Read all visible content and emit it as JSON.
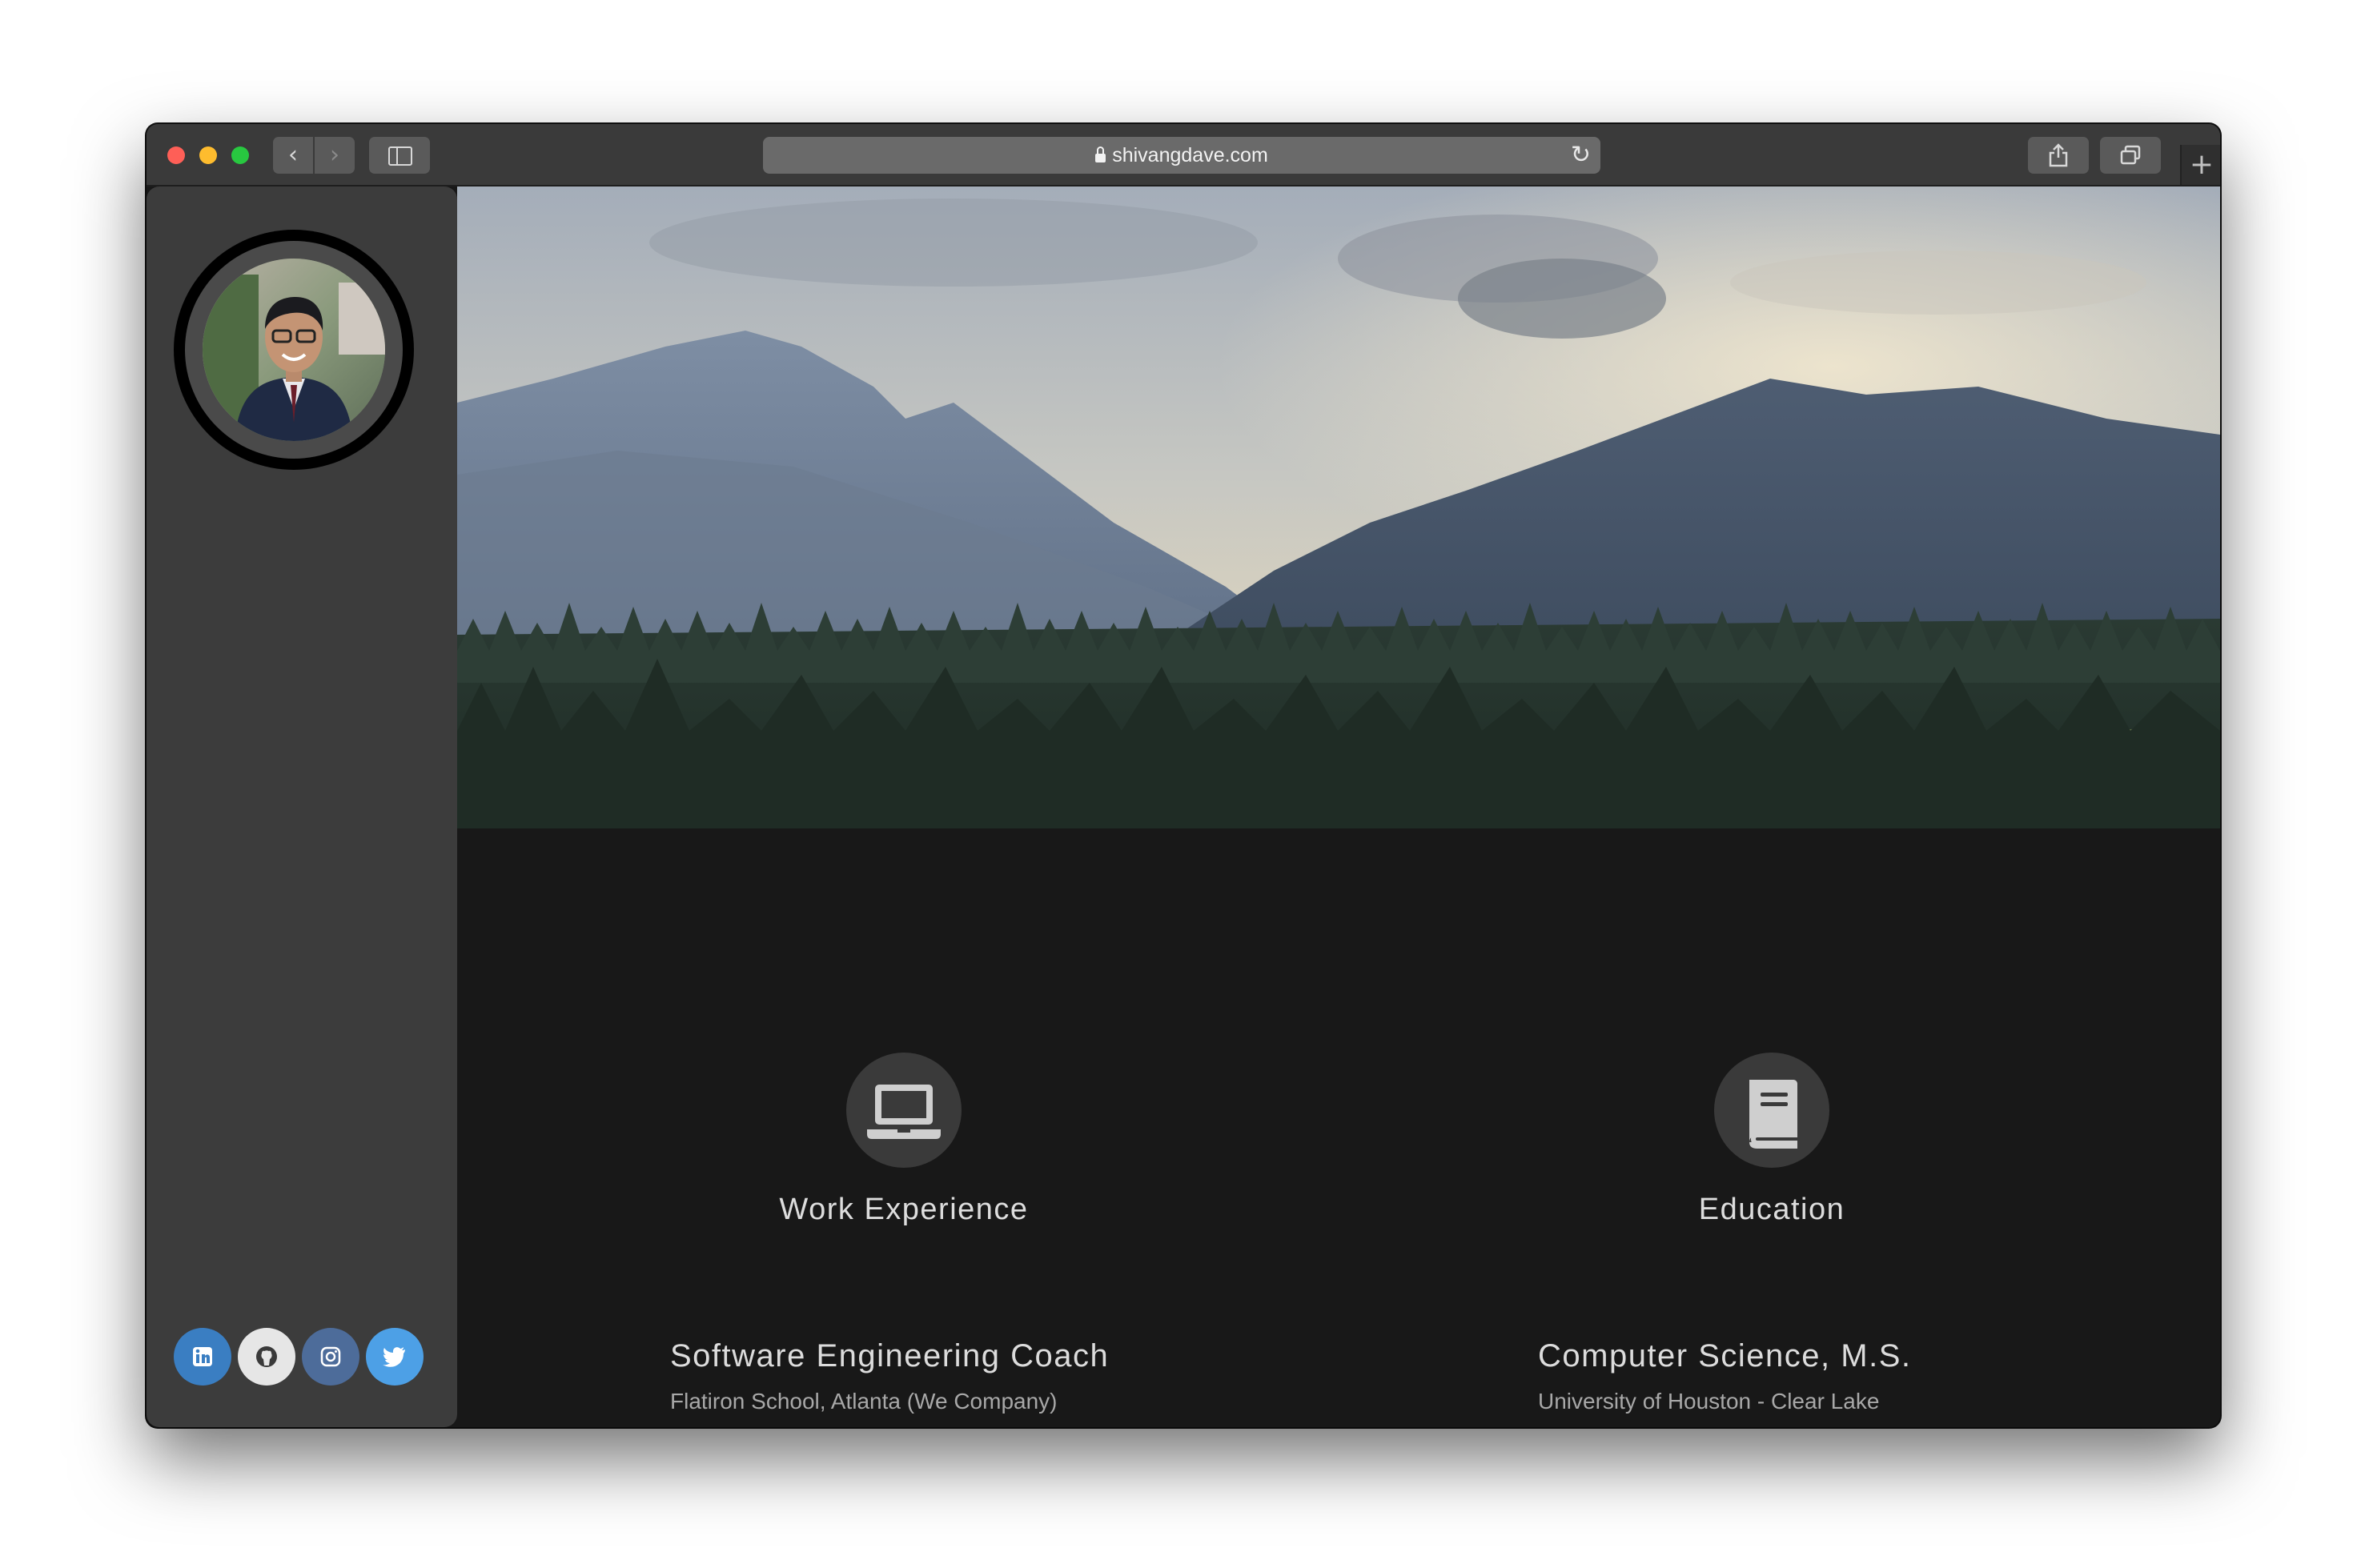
{
  "browser": {
    "url": "shivangdave.com",
    "back_label": "‹",
    "forward_label": "›",
    "reload_label": "↻",
    "share_label": "⇪",
    "tabs_label": "⧉",
    "new_tab_label": "+"
  },
  "colors": {
    "sidebar_bg": "#3c3c3c",
    "content_bg": "#181818",
    "linkedin": "#3a7ec2",
    "github": "#e6e6e6",
    "instagram": "#4d6c9a",
    "twitter": "#4da0e6"
  },
  "sidebar": {
    "avatar_icon": "profile-photo",
    "social_links": [
      {
        "icon": "linkedin-icon"
      },
      {
        "icon": "github-icon"
      },
      {
        "icon": "instagram-icon"
      },
      {
        "icon": "twitter-icon"
      }
    ]
  },
  "hero": {
    "image": "mountain-forest-landscape"
  },
  "sections": {
    "work": {
      "icon": "laptop-icon",
      "title": "Work Experience",
      "item_title": "Software Engineering Coach",
      "item_sub": "Flatiron School, Atlanta (We Company)"
    },
    "education": {
      "icon": "book-icon",
      "title": "Education",
      "item_title": "Computer Science, M.S.",
      "item_sub": "University of Houston - Clear Lake"
    }
  }
}
